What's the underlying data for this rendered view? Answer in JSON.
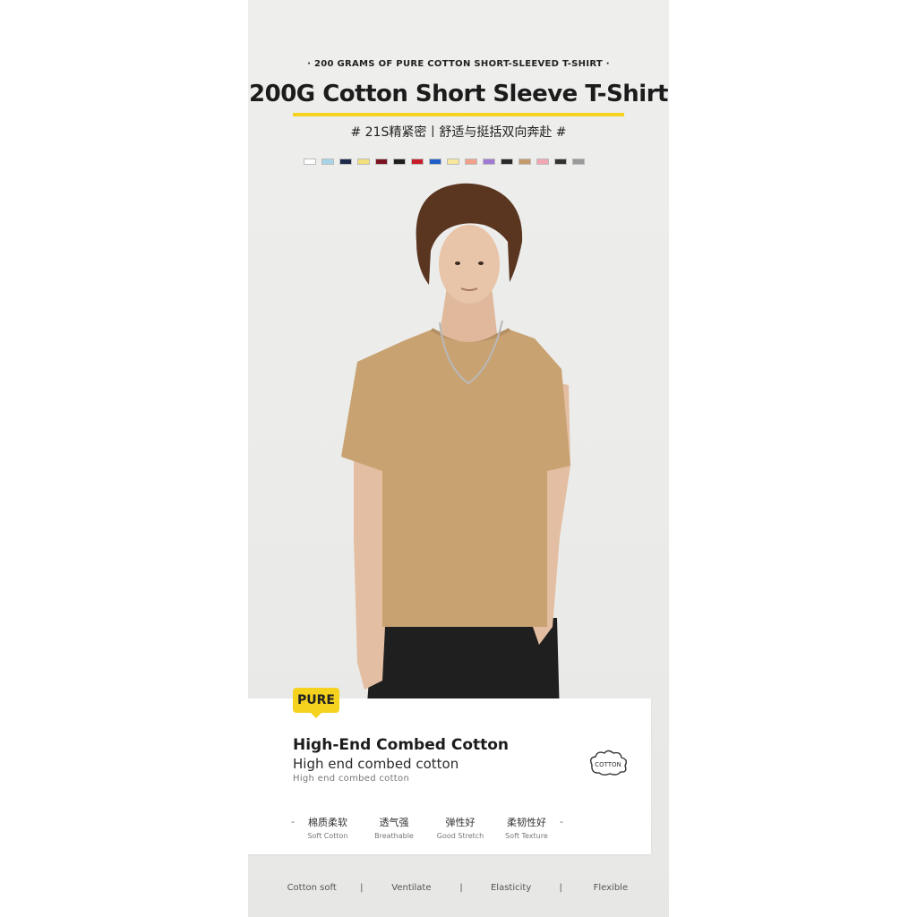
{
  "header": {
    "kicker": "· 200 GRAMS OF PURE COTTON SHORT-SLEEVED T-SHIRT ·",
    "title": "200G Cotton Short Sleeve T-Shirt",
    "subtitle": "# 21S精紧密丨舒适与挺括双向奔赴 #"
  },
  "colors": {
    "accent": "#f4d21d",
    "swatches": [
      "#ffffff",
      "#a8d4ea",
      "#1d2a4a",
      "#f3df7a",
      "#7a1420",
      "#1e1e1e",
      "#c81e2a",
      "#1f5fc8",
      "#f6e79c",
      "#f2a08a",
      "#a07ad2",
      "#2a2a2a",
      "#c49a6a",
      "#f1a6b2",
      "#333333",
      "#9a9a9a"
    ]
  },
  "card": {
    "tag": "PURE",
    "title": "High-End Combed Cotton",
    "subtitle": "High end combed cotton",
    "caption": "High end combed cotton",
    "logo_text": "COTTON",
    "features": [
      {
        "cn": "棉质柔软",
        "en": "Soft Cotton"
      },
      {
        "cn": "透气强",
        "en": "Breathable"
      },
      {
        "cn": "弹性好",
        "en": "Good Stretch"
      },
      {
        "cn": "柔韧性好",
        "en": "Soft Texture"
      }
    ]
  },
  "bottom": {
    "items": [
      "Cotton soft",
      "Ventilate",
      "Elasticity",
      "Flexible"
    ]
  }
}
